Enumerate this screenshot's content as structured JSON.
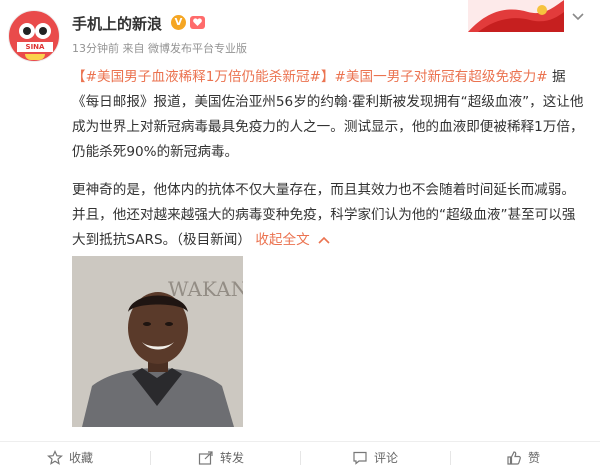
{
  "post": {
    "author": "手机上的新浪",
    "verified_badge": "V",
    "meta": "13分钟前 来自 微博发布平台专业版",
    "paragraph1": {
      "topic1": "【#美国男子血液稀释1万倍仍能杀新冠#】",
      "topic2": "#美国一男子对新冠有超级免疫力#",
      "text": " 据《每日邮报》报道，美国佐治亚州56岁的约翰·霍利斯被发现拥有“超级血液”，这让他成为世界上对新冠病毒最具免疫力的人之一。测试显示，他的血液即便被稀释1万倍，仍能杀死90%的新冠病毒。"
    },
    "paragraph2": {
      "text": "更神奇的是，他体内的抗体不仅大量存在，而且其效力也不会随着时间延长而减弱。并且，他还对越来越强大的病毒变种免疫，科学家们认为他的“超级血液”甚至可以强大到抵抗SARS。（极目新闻）",
      "collapse_label": "收起全文"
    },
    "photo_bg_text": "WAKANDA FOREVER"
  },
  "footer": {
    "favorite": "收藏",
    "share": "转发",
    "comment": "评论",
    "like": "赞"
  },
  "colors": {
    "link": "#eb7350",
    "badge": "#f5a623",
    "avatar": "#e94b4b"
  },
  "icons": [
    "weibo-avatar-icon",
    "verified-icon",
    "fan-badge-icon",
    "chevron-down-icon",
    "chevron-up-icon",
    "star-icon",
    "share-icon",
    "comment-icon",
    "thumbs-up-icon"
  ]
}
